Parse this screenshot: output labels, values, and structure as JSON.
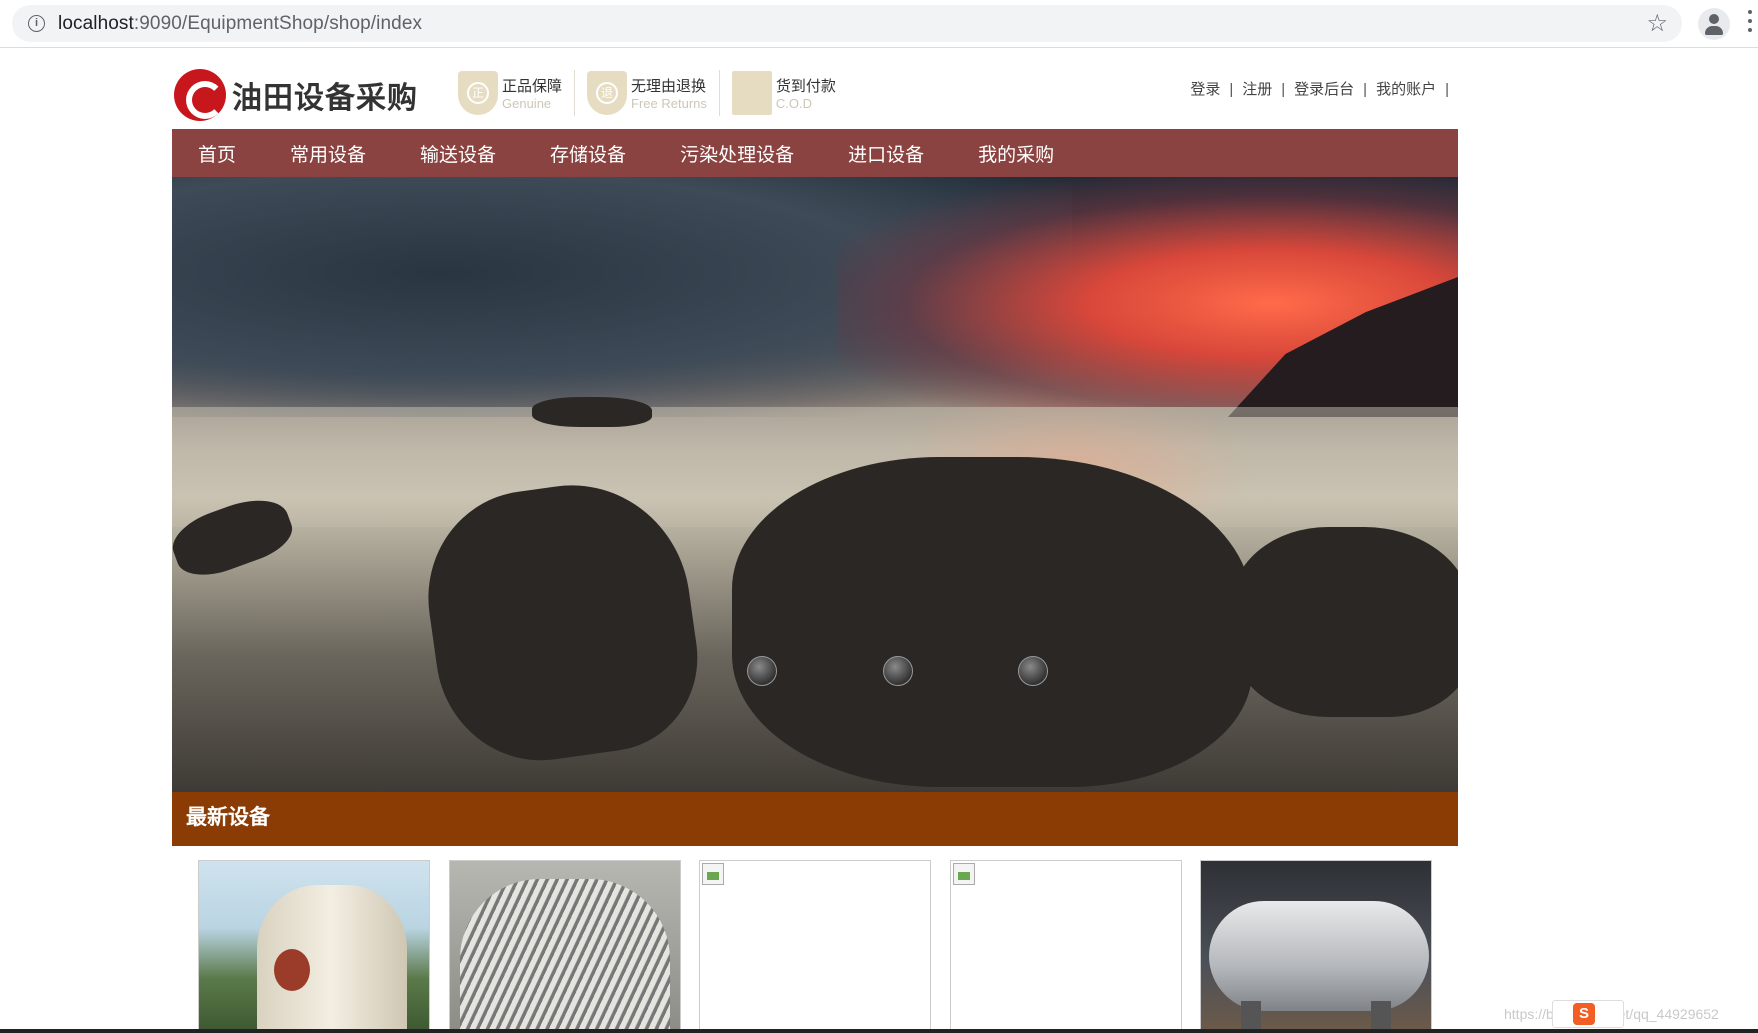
{
  "browser": {
    "url_host": "localhost",
    "url_rest": ":9090/EquipmentShop/shop/index"
  },
  "header": {
    "logo_text": "油田设备采购",
    "badges": [
      {
        "title": "正品保障",
        "subtitle": "Genuine",
        "icon_char": "正"
      },
      {
        "title": "无理由退换",
        "subtitle": "Free Returns",
        "icon_char": "退"
      },
      {
        "title": "货到付款",
        "subtitle": "C.O.D",
        "icon_char": ""
      }
    ],
    "links": [
      "登录",
      "注册",
      "登录后台",
      "我的账户"
    ]
  },
  "nav": {
    "items": [
      "首页",
      "常用设备",
      "输送设备",
      "存储设备",
      "污染处理设备",
      "进口设备",
      "我的采购"
    ]
  },
  "banner": {
    "slide_count": 3
  },
  "section": {
    "title": "最新设备"
  },
  "watermark": "https://blog.csdn.net/qq_44929652",
  "ime_label": "S"
}
